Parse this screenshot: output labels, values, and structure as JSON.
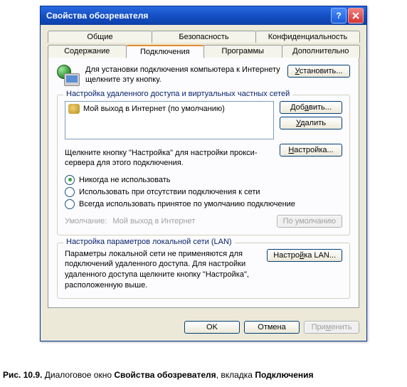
{
  "window": {
    "title": "Свойства обозревателя"
  },
  "tabs": {
    "row1": [
      "Общие",
      "Безопасность",
      "Конфиденциальность"
    ],
    "row2": [
      "Содержание",
      "Подключения",
      "Программы",
      "Дополнительно"
    ],
    "active": "Подключения"
  },
  "setup": {
    "text": "Для установки подключения компьютера к Интернету щелкните эту кнопку.",
    "button": "Установить..."
  },
  "dialup_group": {
    "title": "Настройка удаленного доступа и виртуальных частных сетей",
    "items": [
      "Мой выход в Интернет (по умолчанию)"
    ],
    "add": "Добавить...",
    "remove": "Удалить",
    "settings": "Настройка...",
    "hint": "Щелкните кнопку \"Настройка\" для настройки прокси-сервера для этого подключения.",
    "radios": {
      "never": "Никогда не использовать",
      "when_no_net": "Использовать при отсутствии подключения к сети",
      "always": "Всегда использовать принятое по умолчанию подключение",
      "selected": "never"
    },
    "default_label": "Умолчание:",
    "default_value": "Мой выход в Интернет",
    "default_btn": "По умолчанию"
  },
  "lan_group": {
    "title": "Настройка параметров локальной сети (LAN)",
    "text": "Параметры локальной сети не применяются для подключений удаленного доступа. Для настройки удаленного доступа щелкните кнопку \"Настройка\", расположенную выше.",
    "button": "Настройка LAN..."
  },
  "buttons": {
    "ok": "OK",
    "cancel": "Отмена",
    "apply": "Применить"
  },
  "caption": {
    "prefix": "Рис. 10.9.",
    "mid1": " Диалоговое окно ",
    "b1": "Свойства обозревателя",
    "mid2": ", вкладка ",
    "b2": "Подключения"
  }
}
